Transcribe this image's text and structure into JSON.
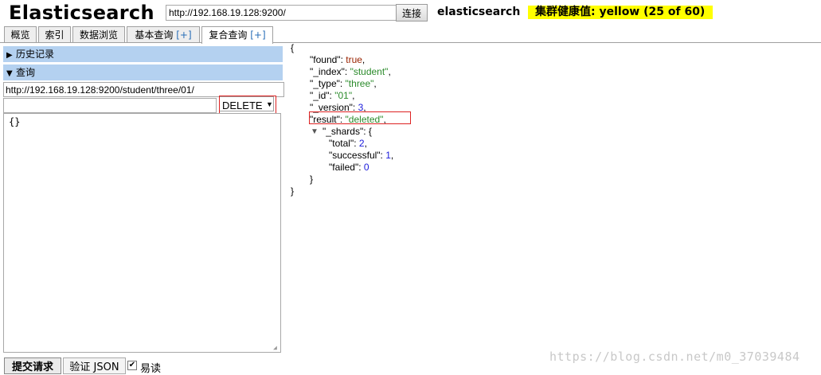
{
  "header": {
    "title": "Elasticsearch",
    "server_url": "http://192.168.19.128:9200/",
    "connect_label": "连接",
    "cluster_name": "elasticsearch",
    "health_text": "集群健康值: yellow (25 of 60)",
    "health_color": "#ffff00"
  },
  "tabs": [
    {
      "label": "概览"
    },
    {
      "label": "索引"
    },
    {
      "label": "数据浏览"
    },
    {
      "label": "基本查询",
      "plus": "[+]"
    },
    {
      "label": "复合查询",
      "plus": "[+]",
      "active": true
    }
  ],
  "left": {
    "history_label": "历史记录",
    "query_label": "查询",
    "query_url": "http://192.168.19.128:9200/student/three/01/",
    "path_value": "",
    "method": "DELETE",
    "body": "{}",
    "submit_label": "提交请求",
    "validate_label": "验证 JSON",
    "pretty_label": "易读",
    "pretty_checked": true
  },
  "response": {
    "open_brace": "{",
    "close_brace": "}",
    "found_key": "\"found\"",
    "found_val": "true",
    "index_key": "\"_index\"",
    "index_val": "\"student\"",
    "type_key": "\"_type\"",
    "type_val": "\"three\"",
    "id_key": "\"_id\"",
    "id_val": "\"01\"",
    "version_key": "\"_version\"",
    "version_val": "3",
    "result_key": "\"result\"",
    "result_val": "\"deleted\"",
    "shards_key": "\"_shards\"",
    "shards_open": "{",
    "total_key": "\"total\"",
    "total_val": "2",
    "successful_key": "\"successful\"",
    "successful_val": "1",
    "failed_key": "\"failed\"",
    "failed_val": "0",
    "shards_close": "}"
  },
  "watermark": "https://blog.csdn.net/m0_37039484"
}
